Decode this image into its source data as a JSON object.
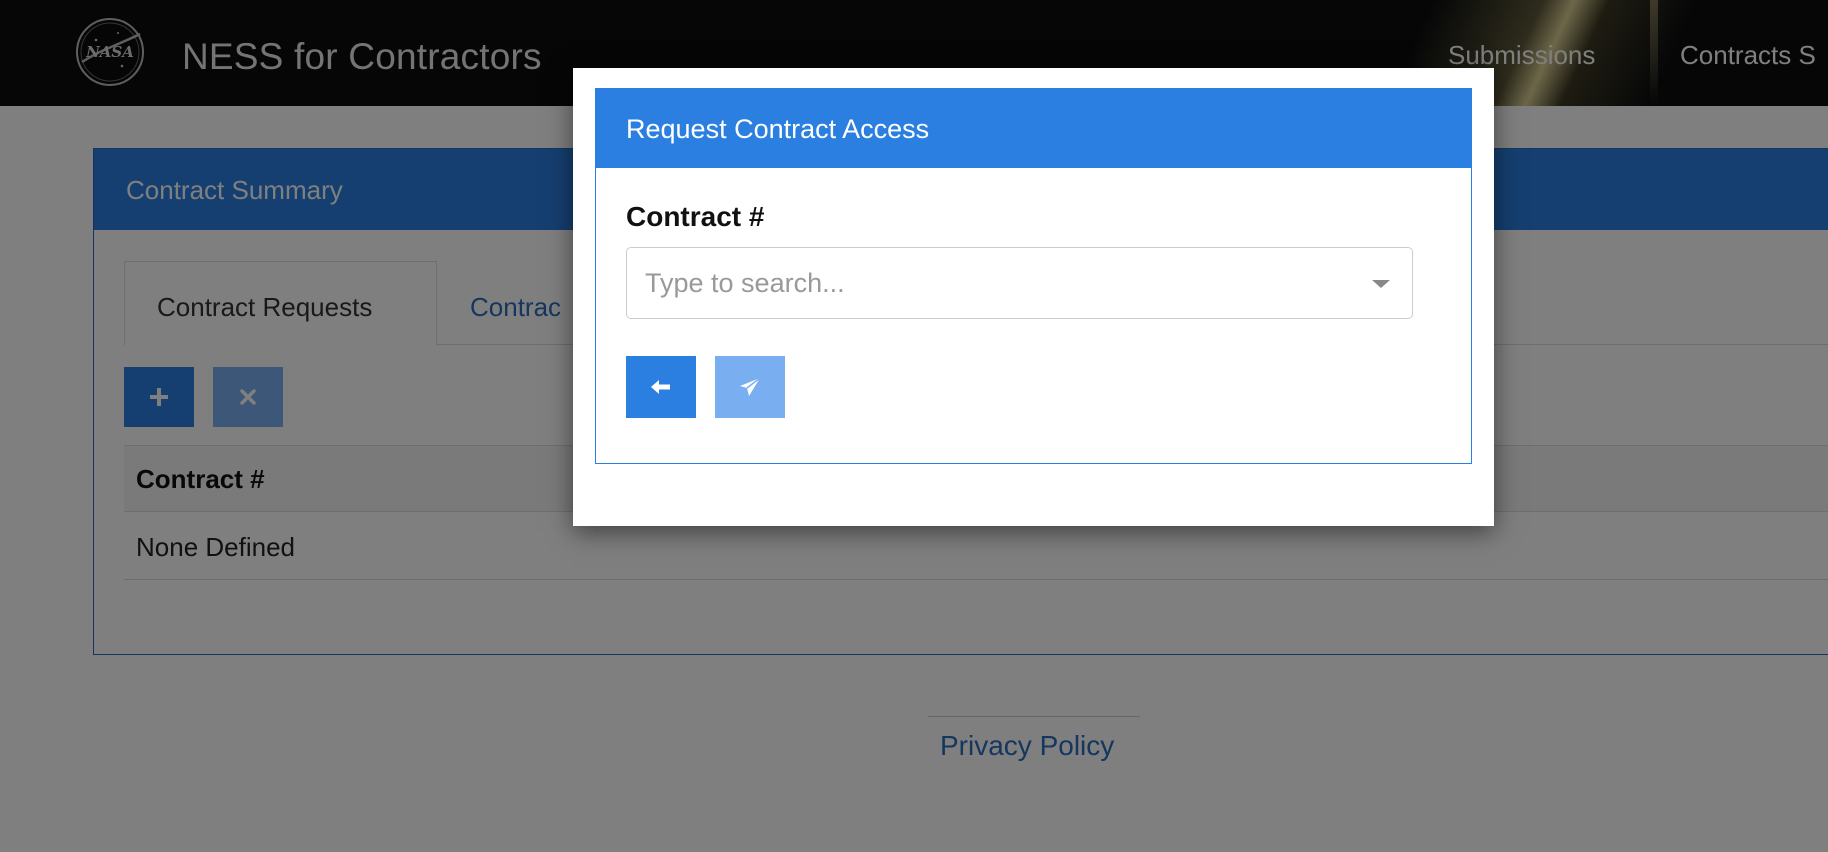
{
  "app": {
    "brand": "NESS for Contractors",
    "logo_text": "NASA"
  },
  "nav": {
    "items": [
      {
        "label": "Submissions"
      },
      {
        "label": "Contracts S"
      }
    ]
  },
  "panel": {
    "heading": "Contract Summary",
    "tabs": [
      {
        "label": "Contract Requests",
        "active": true
      },
      {
        "label": "Contrac",
        "active": false
      }
    ],
    "toolbar": {
      "add_icon": "plus-icon",
      "remove_icon": "times-icon"
    },
    "table": {
      "columns": [
        "Contract #"
      ],
      "rows": [
        [
          "None Defined"
        ]
      ]
    }
  },
  "footer": {
    "privacy_link": "Privacy Policy"
  },
  "modal": {
    "title": "Request Contract Access",
    "field_label": "Contract #",
    "select": {
      "placeholder": "Type to search...",
      "value": ""
    },
    "buttons": {
      "back_icon": "arrow-left-icon",
      "submit_icon": "paper-plane-icon"
    }
  },
  "colors": {
    "primary": "#2a7fe0",
    "primary_disabled": "#79aef0",
    "link": "#2a6fbe",
    "navbar": "#0c0d0f"
  }
}
